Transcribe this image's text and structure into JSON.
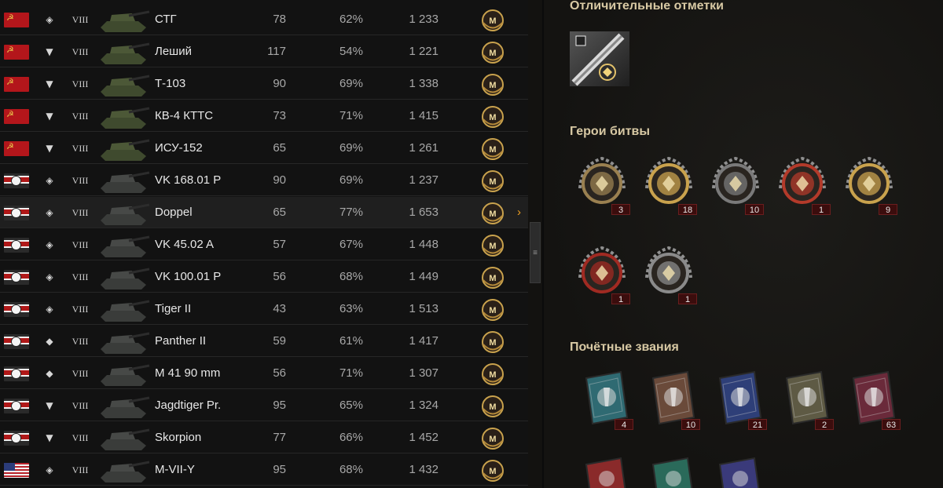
{
  "vehicles": [
    {
      "nation": "ussr",
      "class_icon": "heavy-tank-icon",
      "tier": "VIII",
      "name": "СТГ",
      "battles": "78",
      "winrate": "62%",
      "avg_exp": "1 233"
    },
    {
      "nation": "ussr",
      "class_icon": "td-icon",
      "tier": "VIII",
      "name": "Леший",
      "battles": "117",
      "winrate": "54%",
      "avg_exp": "1 221"
    },
    {
      "nation": "ussr",
      "class_icon": "td-icon",
      "tier": "VIII",
      "name": "Т-103",
      "battles": "90",
      "winrate": "69%",
      "avg_exp": "1 338"
    },
    {
      "nation": "ussr",
      "class_icon": "td-icon",
      "tier": "VIII",
      "name": "КВ-4 КТТС",
      "battles": "73",
      "winrate": "71%",
      "avg_exp": "1 415"
    },
    {
      "nation": "ussr",
      "class_icon": "td-icon",
      "tier": "VIII",
      "name": "ИСУ-152",
      "battles": "65",
      "winrate": "69%",
      "avg_exp": "1 261"
    },
    {
      "nation": "germany",
      "class_icon": "heavy-tank-icon",
      "tier": "VIII",
      "name": "VK 168.01 P",
      "battles": "90",
      "winrate": "69%",
      "avg_exp": "1 237"
    },
    {
      "nation": "germany",
      "class_icon": "heavy-tank-icon",
      "tier": "VIII",
      "name": "Doppel",
      "battles": "65",
      "winrate": "77%",
      "avg_exp": "1 653",
      "selected": true
    },
    {
      "nation": "germany",
      "class_icon": "heavy-tank-icon",
      "tier": "VIII",
      "name": "VK 45.02 A",
      "battles": "57",
      "winrate": "67%",
      "avg_exp": "1 448"
    },
    {
      "nation": "germany",
      "class_icon": "heavy-tank-icon",
      "tier": "VIII",
      "name": "VK 100.01 P",
      "battles": "56",
      "winrate": "68%",
      "avg_exp": "1 449"
    },
    {
      "nation": "germany",
      "class_icon": "heavy-tank-icon",
      "tier": "VIII",
      "name": "Tiger II",
      "battles": "43",
      "winrate": "63%",
      "avg_exp": "1 513"
    },
    {
      "nation": "germany",
      "class_icon": "medium-tank-icon",
      "tier": "VIII",
      "name": "Panther II",
      "battles": "59",
      "winrate": "61%",
      "avg_exp": "1 417"
    },
    {
      "nation": "germany",
      "class_icon": "medium-tank-icon",
      "tier": "VIII",
      "name": "M 41 90 mm",
      "battles": "56",
      "winrate": "71%",
      "avg_exp": "1 307"
    },
    {
      "nation": "germany",
      "class_icon": "td-icon",
      "tier": "VIII",
      "name": "Jagdtiger Pr.",
      "battles": "95",
      "winrate": "65%",
      "avg_exp": "1 324"
    },
    {
      "nation": "germany",
      "class_icon": "td-icon",
      "tier": "VIII",
      "name": "Skorpion",
      "battles": "77",
      "winrate": "66%",
      "avg_exp": "1 452"
    },
    {
      "nation": "usa",
      "class_icon": "heavy-tank-icon",
      "tier": "VIII",
      "name": "M-VII-Y",
      "battles": "95",
      "winrate": "68%",
      "avg_exp": "1 432"
    }
  ],
  "mastery_badge_label": "M",
  "selected_arrow": "›",
  "scroll_handle": "≡",
  "sections": {
    "marks_title": "Отличительные отметки",
    "heroes_title": "Герои битвы",
    "honors_title": "Почётные звания"
  },
  "heroes_medals": [
    {
      "icon": "defender-medal-icon",
      "count": "3"
    },
    {
      "icon": "top-gun-medal-icon",
      "count": "18"
    },
    {
      "icon": "steel-wall-medal-icon",
      "count": "10"
    },
    {
      "icon": "confederate-medal-icon",
      "count": "1"
    },
    {
      "icon": "invader-medal-icon",
      "count": "9"
    },
    {
      "icon": "brothers-in-arms-medal-icon",
      "count": "1"
    },
    {
      "icon": "fighter-medal-icon",
      "count": "1"
    }
  ],
  "honor_badges": [
    {
      "icon": "sword-badge-icon",
      "count": "4"
    },
    {
      "icon": "tank-badge-icon",
      "count": "10"
    },
    {
      "icon": "tower-badge-icon",
      "count": "21"
    },
    {
      "icon": "chevron-badge-icon",
      "count": "2"
    },
    {
      "icon": "crossed-badge-icon",
      "count": "63"
    }
  ],
  "colors": {
    "accent_gold": "#c9a24d",
    "count_bg": "#3b0d0d",
    "section_title": "#d8c9a4"
  }
}
